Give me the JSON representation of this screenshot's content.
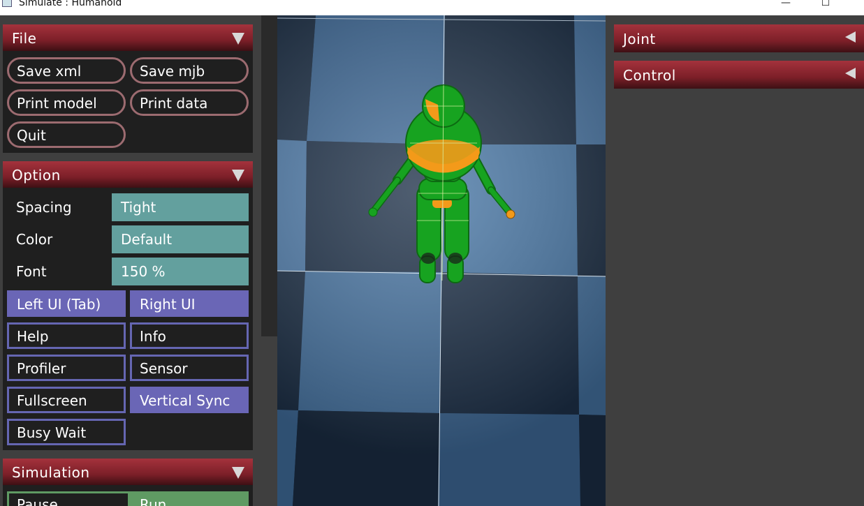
{
  "window": {
    "title": "Simulate : Humanoid",
    "minimize_glyph": "—",
    "maximize_glyph": "☐"
  },
  "file": {
    "title": "File",
    "buttons": [
      "Save xml",
      "Save mjb",
      "Print model",
      "Print data",
      "Quit"
    ]
  },
  "option": {
    "title": "Option",
    "rows": [
      {
        "label": "Spacing",
        "value": "Tight"
      },
      {
        "label": "Color",
        "value": "Default"
      },
      {
        "label": "Font",
        "value": "150 %"
      }
    ],
    "toggles": [
      {
        "label": "Left UI (Tab)",
        "on": true
      },
      {
        "label": "Right UI",
        "on": true
      },
      {
        "label": "Help",
        "on": false
      },
      {
        "label": "Info",
        "on": false
      },
      {
        "label": "Profiler",
        "on": false
      },
      {
        "label": "Sensor",
        "on": false
      },
      {
        "label": "Fullscreen",
        "on": false
      },
      {
        "label": "Vertical Sync",
        "on": true
      },
      {
        "label": "Busy Wait",
        "on": false
      }
    ]
  },
  "simulation": {
    "title": "Simulation",
    "pause_label": "Pause",
    "run_label": "Run"
  },
  "right": {
    "joint_title": "Joint",
    "control_title": "Control"
  },
  "colors": {
    "header_red": "#8e2630",
    "select_teal": "#63a09e",
    "toggle_purple": "#6a66b6",
    "file_button_border": "#9c6b70",
    "run_green": "#5f9a63",
    "body_green": "#16a31e",
    "body_orange": "#f39a1a"
  },
  "icons": {
    "collapse_open": "triangle-down-icon",
    "collapse_closed": "triangle-left-icon"
  }
}
